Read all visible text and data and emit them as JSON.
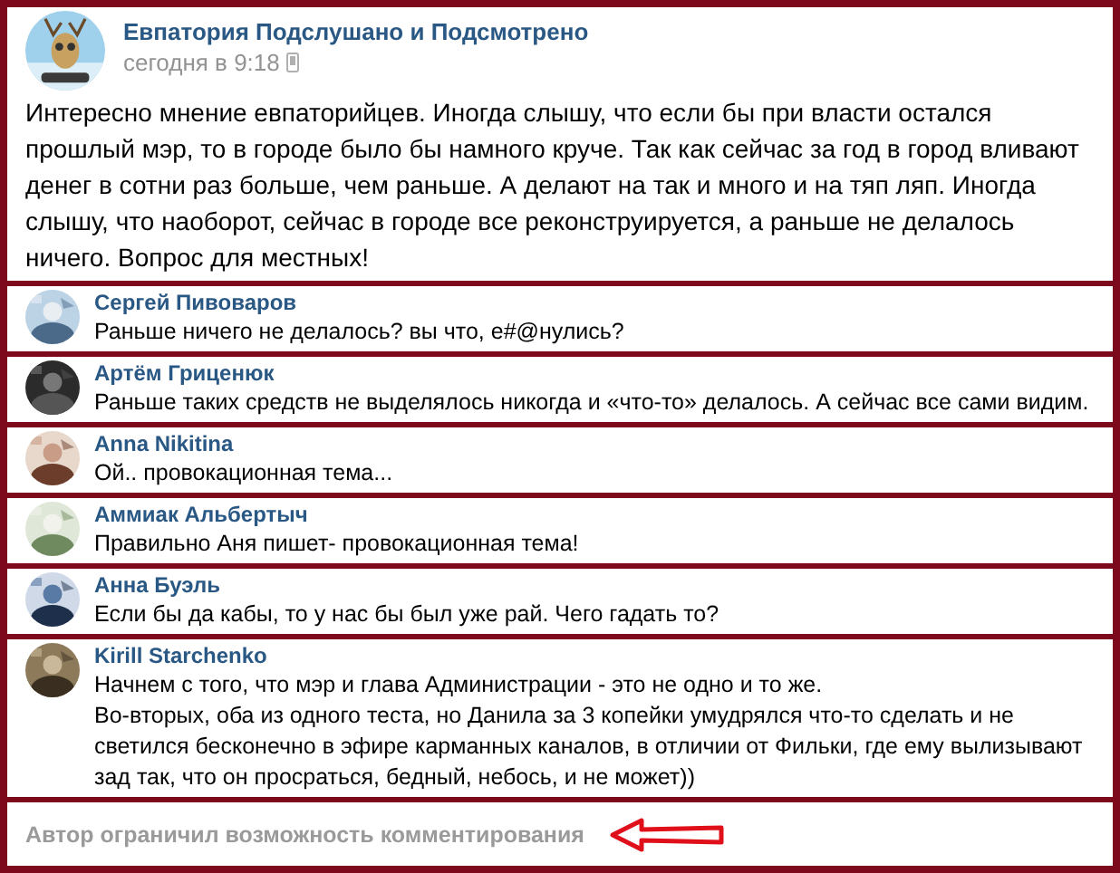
{
  "post": {
    "author": "Евпатория Подслушано и Подсмотрено",
    "time": "сегодня в 9:18",
    "text": "Интересно мнение евпаторийцев. Иногда слышу, что если бы при власти остался прошлый мэр, то в городе было бы намного круче. Так как сейчас за год в город вливают денег в сотни раз больше, чем раньше. А делают на так и много и на тяп ляп. Иногда слышу, что наоборот, сейчас в городе все реконструируется, а раньше не делалось ничего. Вопрос для местных!"
  },
  "comments": [
    {
      "author": "Сергей Пивоваров",
      "text": "Раньше ничего не делалось? вы что, е#@нулись?"
    },
    {
      "author": "Артём Гриценюк",
      "text": "Раньше таких средств не выделялось никогда и «что-то» делалось. А сейчас все сами видим."
    },
    {
      "author": "Anna Nikitina",
      "text": "Ой.. провокационная тема..."
    },
    {
      "author": "Аммиак Альбертыч",
      "text": "Правильно Аня пишет- провокационная тема!"
    },
    {
      "author": "Анна Буэль",
      "text": "Если бы да кабы, то у нас бы был уже рай. Чего гадать то?"
    },
    {
      "author": "Kirill Starchenko",
      "text": "Начнем с того, что мэр и глава Администрации - это не одно и то же.\nВо-вторых, оба из одного теста, но Данила за 3 копейки умудрялся что-то сделать и не светился бесконечно в эфире карманных каналов, в отличии от Фильки, где ему вылизывают зад так, что он просраться, бедный, небось, и не может))"
    }
  ],
  "footer": {
    "text": "Автор ограничил возможность комментирования"
  }
}
